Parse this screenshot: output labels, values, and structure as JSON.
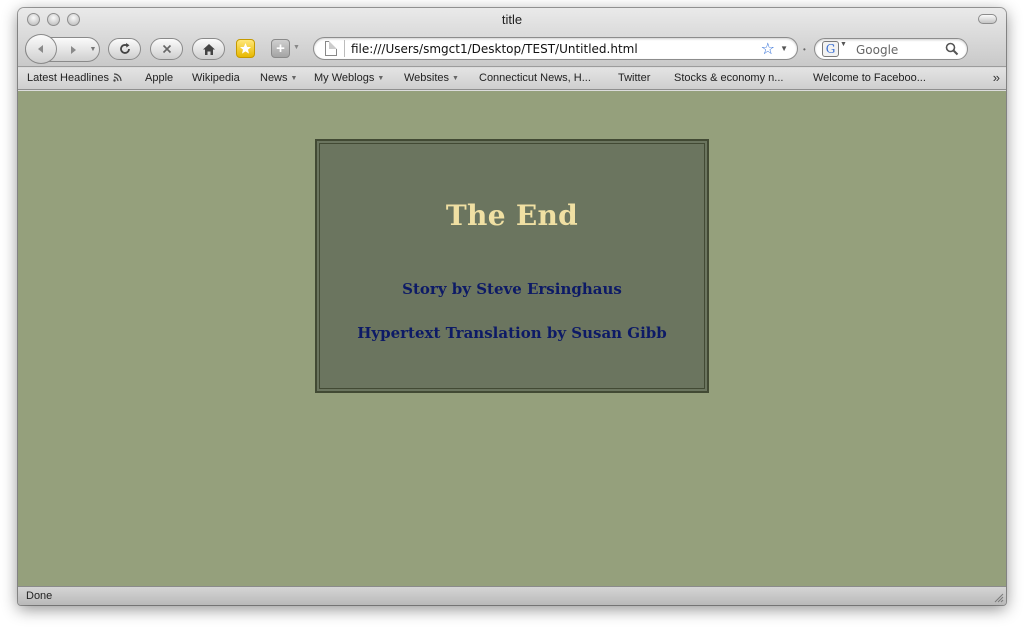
{
  "window": {
    "title": "title"
  },
  "toolbar": {
    "url": "file:///Users/smgct1/Desktop/TEST/Untitled.html",
    "search_placeholder": "Google",
    "search_engine_letter": "G"
  },
  "bookmarks": [
    {
      "label": "Latest Headlines",
      "icon": "rss-icon"
    },
    {
      "label": "Apple"
    },
    {
      "label": "Wikipedia"
    },
    {
      "label": "News",
      "menu": true
    },
    {
      "label": "My Weblogs",
      "menu": true
    },
    {
      "label": "Websites",
      "menu": true
    },
    {
      "label": "Connecticut News, H..."
    },
    {
      "label": "Twitter"
    },
    {
      "label": "Stocks & economy n..."
    },
    {
      "label": "Welcome to Faceboo..."
    }
  ],
  "overflow_label": "»",
  "page": {
    "heading": "The End",
    "credit_story": "Story by Steve Ersinghaus",
    "credit_translation": "Hypertext Translation by Susan Gibb",
    "background": "#95a07c",
    "box_color": "#6b755f",
    "heading_color": "#f0e0a3",
    "credit_color": "#0d1a66"
  },
  "status": {
    "text": "Done"
  }
}
